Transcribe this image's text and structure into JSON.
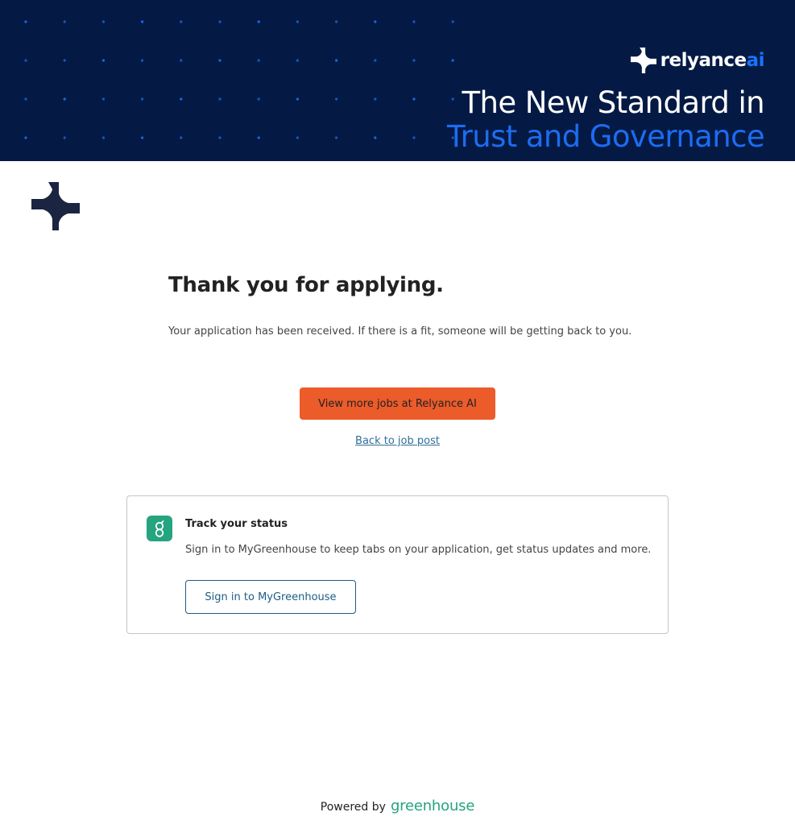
{
  "banner": {
    "brand_name": "relyance",
    "brand_suffix": "ai",
    "tagline_line1": "The New Standard in",
    "tagline_line2": "Trust and Governance",
    "background_color": "#041a44",
    "accent_color": "#1d6cf2"
  },
  "company_logo": {
    "icon": "relyance-mark-icon",
    "color": "#1b2440"
  },
  "confirmation": {
    "title": "Thank you for applying.",
    "message": "Your application has been received. If there is a fit, someone will be getting back to you."
  },
  "actions": {
    "more_jobs_label": "View more jobs at Relyance AI",
    "more_jobs_color": "#ec5b2a",
    "back_link_label": "Back to job post"
  },
  "track_status": {
    "icon": "greenhouse-g-icon",
    "title": "Track your status",
    "description": "Sign in to MyGreenhouse to keep tabs on your application, get status updates and more.",
    "button_label": "Sign in to MyGreenhouse"
  },
  "footer": {
    "powered_by": "Powered by",
    "provider": "greenhouse",
    "provider_color": "#24a47f"
  }
}
